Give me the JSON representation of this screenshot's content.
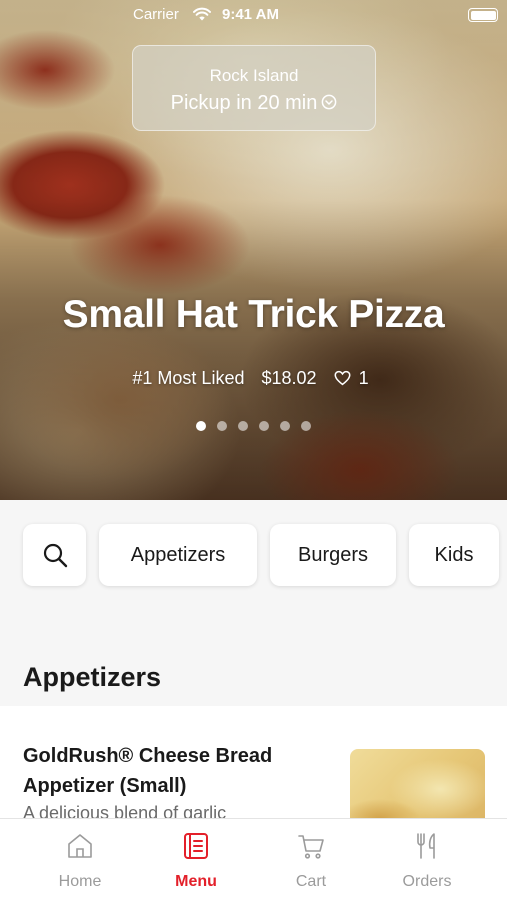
{
  "status_bar": {
    "carrier": "Carrier",
    "time": "9:41 AM"
  },
  "location": {
    "name": "Rock Island",
    "pickup": "Pickup in 20 min"
  },
  "hero": {
    "title": "Small Hat Trick Pizza",
    "badge": "#1 Most Liked",
    "price": "$18.02",
    "likes": "1",
    "slides_total": 6,
    "active_slide": 1
  },
  "categories": [
    "Appetizers",
    "Burgers",
    "Kids"
  ],
  "section": {
    "heading": "Appetizers"
  },
  "menu_item": {
    "name_line1": "GoldRush® Cheese Bread",
    "name_line2": "Appetizer (Small)",
    "description": "A delicious blend of garlic"
  },
  "tabs": [
    {
      "label": "Home",
      "icon": "home-icon",
      "active": false
    },
    {
      "label": "Menu",
      "icon": "menu-icon",
      "active": true
    },
    {
      "label": "Cart",
      "icon": "cart-icon",
      "active": false
    },
    {
      "label": "Orders",
      "icon": "fork-knife-icon",
      "active": false
    }
  ],
  "colors": {
    "accent": "#e3202a",
    "inactive_tab": "#9b9b9b",
    "background": "#f6f6f6"
  }
}
